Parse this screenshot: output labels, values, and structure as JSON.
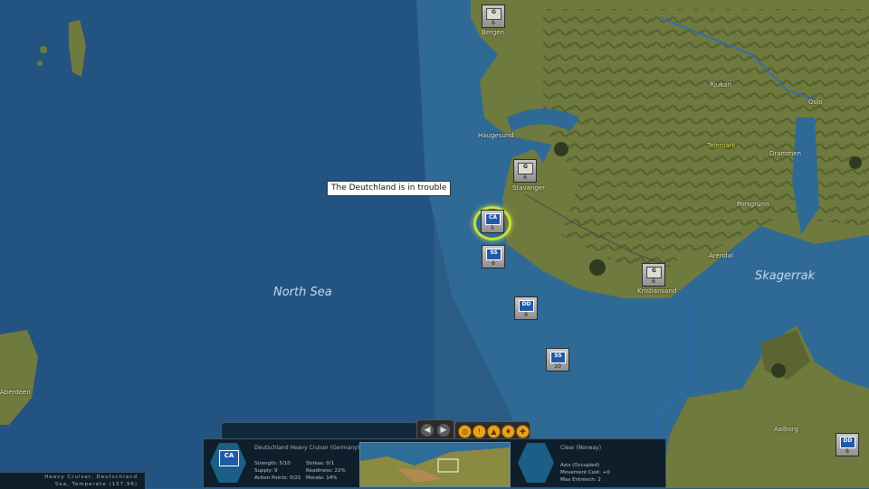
{
  "map": {
    "sea_labels": [
      "North Sea",
      "Skagerrak"
    ],
    "cities": [
      "Bergen",
      "Haugesund",
      "Stavanger",
      "Kristiansand",
      "Oslo",
      "Drammen",
      "Telemark",
      "Porsgrunn",
      "Arendal",
      "Aalborg",
      "Aberdeen",
      "Rjukan"
    ],
    "tooltip": "The Deutchland is in trouble"
  },
  "units": [
    {
      "code": "CA",
      "value": "5",
      "selected": true
    },
    {
      "code": "SS",
      "value": "6"
    },
    {
      "code": "DD",
      "value": "9"
    },
    {
      "code": "SS",
      "value": "10"
    },
    {
      "code": "DD",
      "value": "6"
    },
    {
      "code": "G",
      "value": "6"
    },
    {
      "code": "G",
      "value": "6"
    },
    {
      "code": "G",
      "value": "6"
    }
  ],
  "panel": {
    "unit": {
      "code": "CA",
      "title": "Deutschland Heavy Cruiser (Germany)",
      "strength": "Strength: 5/10",
      "supply": "Supply: 9",
      "action_points": "Action Points: 0/21",
      "strikes": "Strikes: 0/1",
      "readiness": "Readiness: 22%",
      "morale": "Morale: 14%"
    },
    "terrain": {
      "title": "Clear (Norway)",
      "owner": "Axis (Occupied)",
      "movement": "Movement Cost: +0",
      "entrench": "Max Entrench: 2"
    }
  },
  "status": {
    "line1": "Heavy Cruiser, Deutschland",
    "line2": "Sea, Temperate (157,96)"
  },
  "colors": {
    "sea": "#2a5c86",
    "land": "#6f7a3e",
    "highlight": "#c7e03a",
    "unit_blue": "#1f5aa8"
  }
}
